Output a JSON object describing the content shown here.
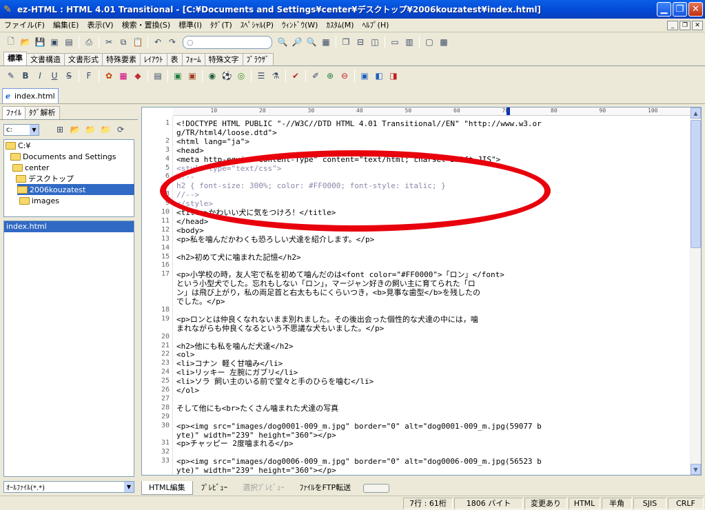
{
  "window": {
    "title": "ez-HTML : HTML 4.01 Transitional - [C:¥Documents and Settings¥center¥デスクトップ¥2006kouzatest¥index.html]"
  },
  "menu": [
    "ファイル(F)",
    "編集(E)",
    "表示(V)",
    "検索・置換(S)",
    "標準(I)",
    "ﾀｸﾞ(T)",
    "ｽﾍﾟｼｬﾙ(P)",
    "ｳｨﾝﾄﾞｳ(W)",
    "ｶｽﾀﾑ(M)",
    "ﾍﾙﾌﾟ(H)"
  ],
  "toolbar_tabs": [
    "標準",
    "文書構造",
    "文書形式",
    "特殊要素",
    "ﾚｲｱｳﾄ",
    "表",
    "ﾌｫｰﾑ",
    "特殊文字",
    "ﾌﾞﾗｳｻﾞ"
  ],
  "document_tab": "index.html",
  "left_tabs": [
    "ﾌｧｲﾙ",
    "ﾀｸﾞ解析"
  ],
  "drive": "c:",
  "tree": [
    {
      "label": "C:¥",
      "depth": 0,
      "selected": false
    },
    {
      "label": "Documents and Settings",
      "depth": 1,
      "selected": false
    },
    {
      "label": "center",
      "depth": 2,
      "selected": false
    },
    {
      "label": "デスクトップ",
      "depth": 3,
      "selected": false
    },
    {
      "label": "2006kouzatest",
      "depth": 4,
      "selected": true
    },
    {
      "label": "images",
      "depth": 5,
      "selected": false
    }
  ],
  "files": [
    "index.html"
  ],
  "file_filter": "ｵｰﾙﾌｧｲﾙ(*.*)",
  "ruler": [
    "10",
    "20",
    "30",
    "40",
    "50",
    "60",
    "70",
    "80",
    "90",
    "100"
  ],
  "code_lines": [
    {
      "n": "1",
      "t": "<!DOCTYPE HTML PUBLIC \"-//W3C//DTD HTML 4.01 Transitional//EN\" \"http://www.w3.or"
    },
    {
      "n": "",
      "t": "g/TR/html4/loose.dtd\">"
    },
    {
      "n": "2",
      "t": "<html lang=\"ja\">"
    },
    {
      "n": "3",
      "t": "<head>"
    },
    {
      "n": "4",
      "t": "    <meta http-equiv=\"Content-Type\" content=\"text/html; charset=Shift_JIS\">"
    },
    {
      "n": "5",
      "t": "    <style type=\"text/css\">"
    },
    {
      "n": "6",
      "t": "    <!--"
    },
    {
      "n": "7",
      "t": "        h2  { font-size: 300%; color: #FF0000; font-style: italic; }"
    },
    {
      "n": "8",
      "t": "    //-->"
    },
    {
      "n": "9",
      "t": "    </style>"
    },
    {
      "n": "10",
      "t": "    <title>かわいい犬に気をつけろ！</title>"
    },
    {
      "n": "11",
      "t": "</head>"
    },
    {
      "n": "12",
      "t": "<body>"
    },
    {
      "n": "13",
      "t": "<p>私を噛んだかわくも恐ろしい犬達を紹介します。</p>"
    },
    {
      "n": "14",
      "t": ""
    },
    {
      "n": "15",
      "t": "<h2>初めて犬に噛まれた記憶</h2>"
    },
    {
      "n": "16",
      "t": ""
    },
    {
      "n": "17",
      "t": "<p>小学校の時，友人宅で私を初めて噛んだのは<font color=\"#FF0000\">「ロン」</font>"
    },
    {
      "n": "",
      "t": "という小型犬でした。忘れもしない「ロン」，マージャン好きの飼い主に育てられた「ロ"
    },
    {
      "n": "",
      "t": "ン」は飛び上がり，私の両足首と右太ももにくらいつき，<b>見事な歯型</b>を残したの"
    },
    {
      "n": "",
      "t": "でした。</p>"
    },
    {
      "n": "18",
      "t": ""
    },
    {
      "n": "19",
      "t": "<p>ロンとは仲良くなれないまま別れました。その後出会った個性的な犬達の中には，噛"
    },
    {
      "n": "",
      "t": "まれながらも仲良くなるという不思議な犬もいました。</p>"
    },
    {
      "n": "20",
      "t": ""
    },
    {
      "n": "21",
      "t": "<h2>他にも私を噛んだ犬達</h2>"
    },
    {
      "n": "22",
      "t": "<ol>"
    },
    {
      "n": "23",
      "t": "    <li>コナン  軽く甘噛み</li>"
    },
    {
      "n": "24",
      "t": "    <li>リッキー  左腕にガブリ</li>"
    },
    {
      "n": "25",
      "t": "    <li>ソラ  飼い主のいる前で堂々と手のひらを噛む</li>"
    },
    {
      "n": "26",
      "t": "</ol>"
    },
    {
      "n": "27",
      "t": ""
    },
    {
      "n": "28",
      "t": "そして他にも<br>たくさん噛まれた犬達の写真"
    },
    {
      "n": "29",
      "t": ""
    },
    {
      "n": "30",
      "t": "<p><img src=\"images/dog0001-009_m.jpg\" border=\"0\" alt=\"dog0001-009_m.jpg(59077 b"
    },
    {
      "n": "",
      "t": "yte)\" width=\"239\" height=\"360\"></p>"
    },
    {
      "n": "31",
      "t": "<p>チャッピー  2度噛まれる</p>"
    },
    {
      "n": "32",
      "t": ""
    },
    {
      "n": "33",
      "t": "<p><img src=\"images/dog0006-009_m.jpg\" border=\"0\" alt=\"dog0006-009_m.jpg(56523 b"
    },
    {
      "n": "",
      "t": "yte)\" width=\"239\" height=\"360\"></p>"
    }
  ],
  "bottom_tabs": [
    "HTML編集",
    "ﾌﾟﾚﾋﾞｭｰ",
    "選択ﾌﾟﾚﾋﾞｭｰ",
    "ﾌｧｲﾙをFTP転送"
  ],
  "status": {
    "position": "7行 : 61桁",
    "size": "1806 バイト",
    "modified": "変更あり",
    "mode": "HTML",
    "width": "半角",
    "encoding": "SJIS",
    "newline": "CRLF"
  },
  "colors": {
    "highlight_ring": "#e8000c",
    "selection": "#316ac5",
    "titlebar": "#0348d4"
  }
}
